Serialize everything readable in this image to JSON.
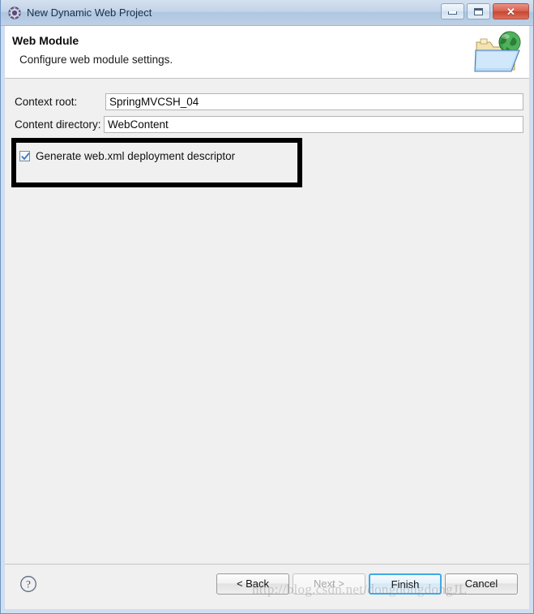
{
  "window": {
    "title": "New Dynamic Web Project",
    "icon": "eclipse-wizard-icon",
    "controls": {
      "minimize": "minimize-button",
      "maximize": "maximize-button",
      "close": "close-button",
      "close_glyph": "✕"
    }
  },
  "header": {
    "title": "Web Module",
    "subtitle": "Configure web module settings.",
    "icon": "web-folder-globe-icon"
  },
  "form": {
    "context_root": {
      "label": "Context root:",
      "value": "SpringMVCSH_04",
      "placeholder": ""
    },
    "content_directory": {
      "label": "Content directory:",
      "value": "WebContent",
      "placeholder": ""
    },
    "generate_webxml": {
      "label": "Generate web.xml deployment descriptor",
      "checked": true
    }
  },
  "annotation": {
    "type": "highlight-rectangle",
    "color": "#000000"
  },
  "footer": {
    "help": "help-button",
    "buttons": [
      {
        "label": "< Back",
        "name": "back-button",
        "state": "enabled"
      },
      {
        "label": "Next >",
        "name": "next-button",
        "state": "disabled"
      },
      {
        "label": "Finish",
        "name": "finish-button",
        "state": "default"
      },
      {
        "label": "Cancel",
        "name": "cancel-button",
        "state": "enabled"
      }
    ]
  },
  "watermark": {
    "text": "http://blog.csdn.net/dongdongdongJL"
  },
  "colors": {
    "titlebar_top": "#d3e0ef",
    "titlebar_bottom": "#bdd0e6",
    "frame": "#cfdef0",
    "body": "#f0f0f0",
    "accent": "#3daae8",
    "close_button": "#d9614f"
  }
}
